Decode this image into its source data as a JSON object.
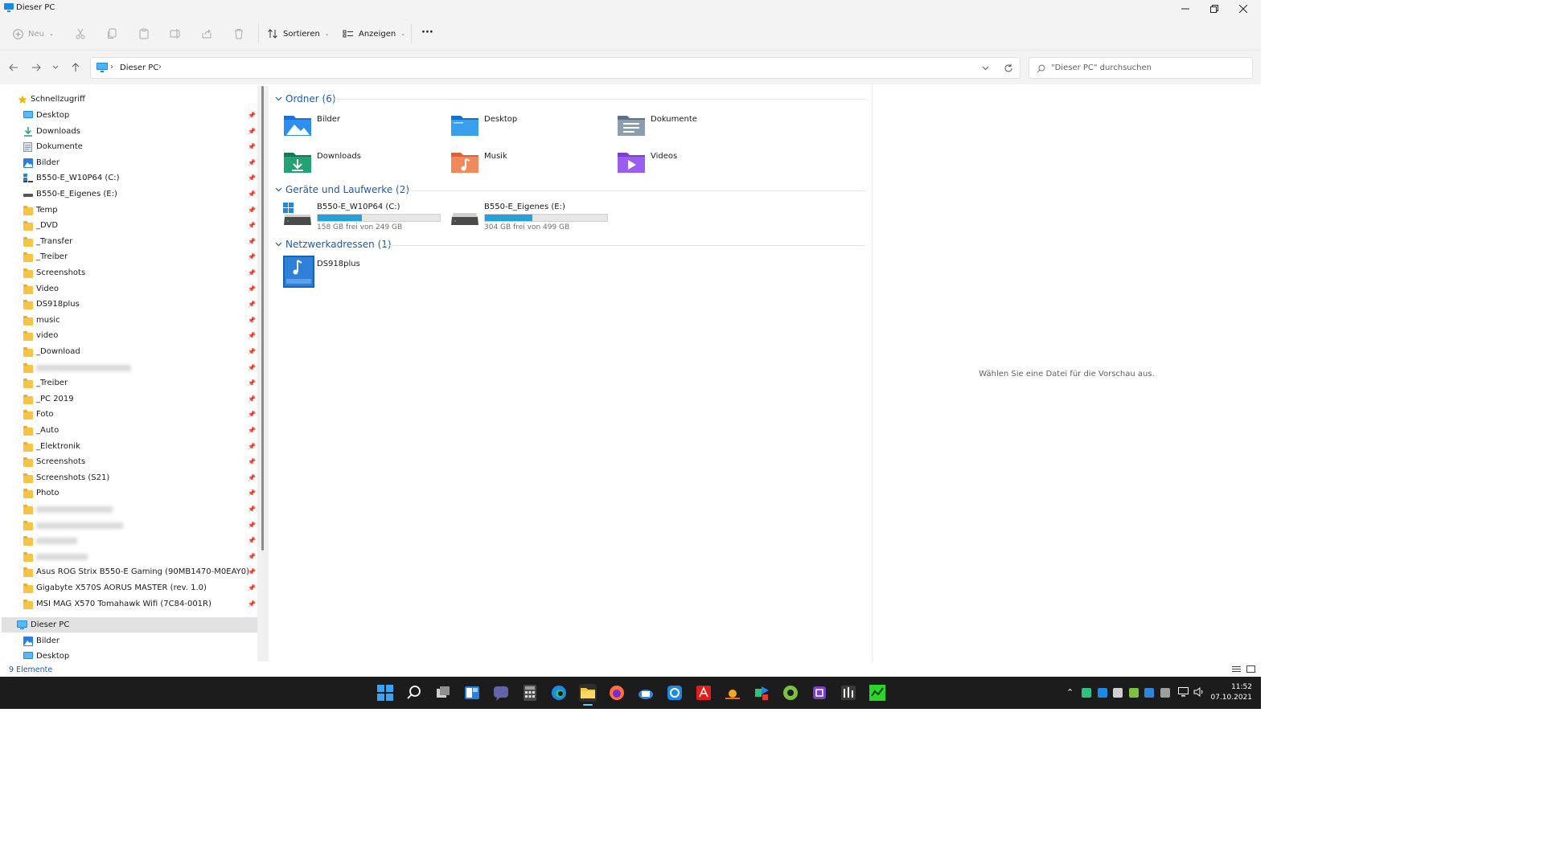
{
  "window": {
    "title": "Dieser PC"
  },
  "toolbar": {
    "new_label": "Neu",
    "sort_label": "Sortieren",
    "view_label": "Anzeigen",
    "more_label": "···"
  },
  "address": {
    "location": "Dieser PC",
    "search_placeholder": "\"Dieser PC\" durchsuchen"
  },
  "nav": {
    "quick_access": "Schnellzugriff",
    "items": [
      "Desktop",
      "Downloads",
      "Dokumente",
      "Bilder",
      "B550-E_W10P64 (C:)",
      "B550-E_Eigenes (E:)",
      "Temp",
      "_DVD",
      "_Transfer",
      "_Treiber",
      "Screenshots",
      "Video",
      "DS918plus",
      "music",
      "video",
      "_Download",
      "",
      "_Treiber",
      "_PC 2019",
      "Foto",
      "_Auto",
      "_Elektronik",
      "Screenshots",
      "Screenshots (S21)",
      "Photo",
      "",
      "",
      "",
      "",
      "Asus ROG Strix B550-E Gaming (90MB1470-M0EAY0)",
      "Gigabyte X570S AORUS MASTER (rev. 1.0)",
      "MSI MAG X570 Tomahawk Wifi (7C84-001R)"
    ],
    "this_pc": "Dieser PC",
    "this_pc_children": [
      "Bilder",
      "Desktop"
    ]
  },
  "content": {
    "folders_header": "Ordner (6)",
    "folders": [
      "Bilder",
      "Desktop",
      "Dokumente",
      "Downloads",
      "Musik",
      "Videos"
    ],
    "drives_header": "Geräte und Laufwerke (2)",
    "drives": [
      {
        "name": "B550-E_W10P64 (C:)",
        "free_text": "158 GB frei von 249 GB",
        "used_fraction": 0.365
      },
      {
        "name": "B550-E_Eigenes (E:)",
        "free_text": "304 GB frei von 499 GB",
        "used_fraction": 0.391
      }
    ],
    "network_header": "Netzwerkadressen (1)",
    "network": [
      "DS918plus"
    ]
  },
  "preview": {
    "message": "Wählen Sie eine Datei für die Vorschau aus."
  },
  "status": {
    "count": "9 Elemente"
  },
  "clock": {
    "time": "11:52",
    "date": "07.10.2021"
  },
  "colors": {
    "accent": "#1f5aa8",
    "drive_bar": "#26a0da",
    "folder": "#f6c344",
    "taskbar": "#1c1c1c"
  }
}
